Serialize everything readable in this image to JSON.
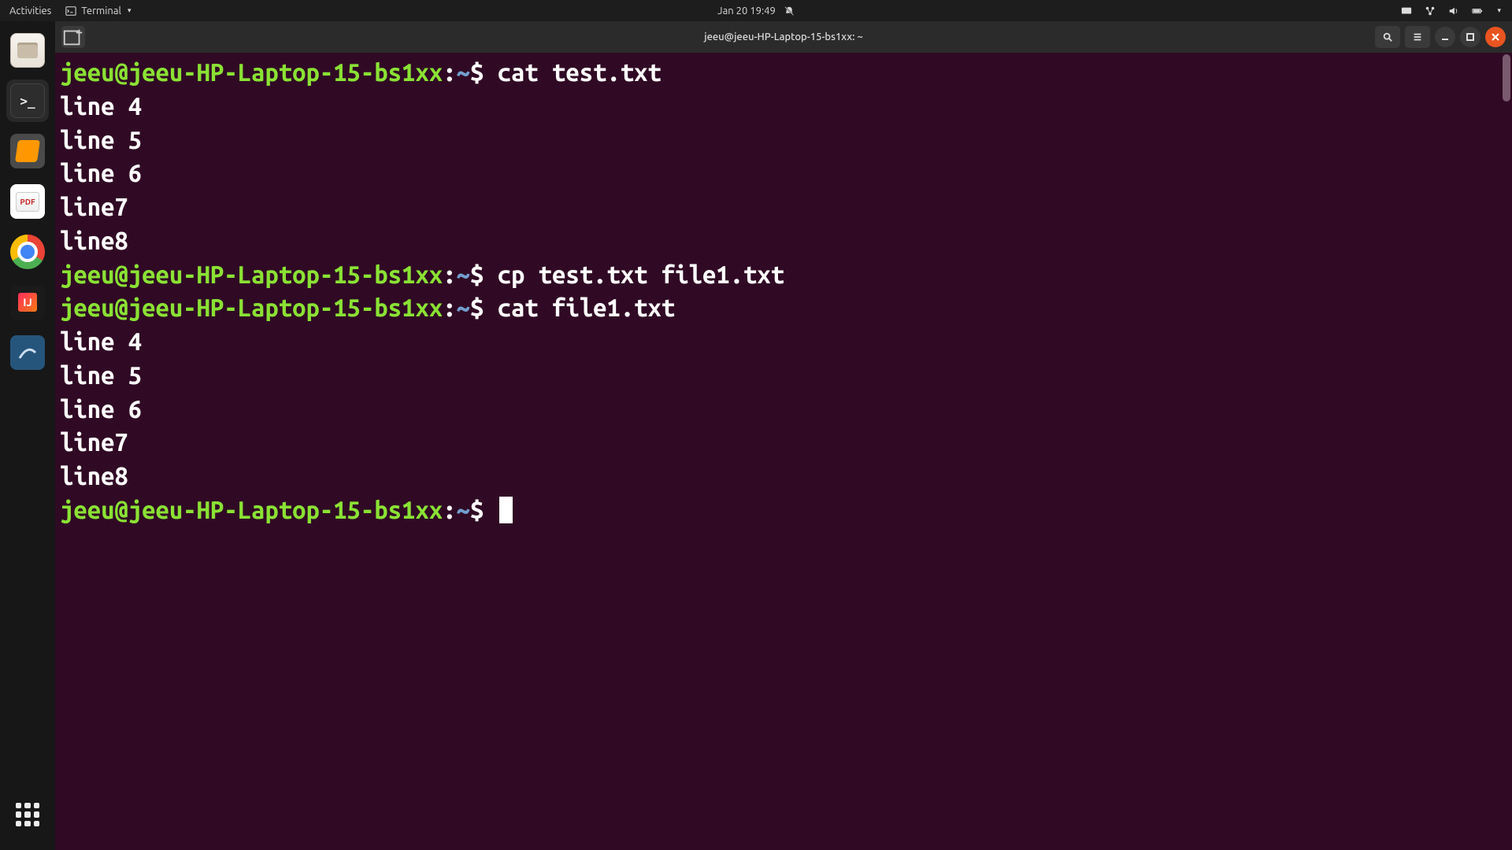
{
  "top_panel": {
    "activities": "Activities",
    "app_name": "Terminal",
    "clock": "Jan 20  19:49"
  },
  "dock": {
    "items": [
      {
        "name": "files",
        "label": "Files"
      },
      {
        "name": "terminal",
        "label": "Terminal"
      },
      {
        "name": "sublime",
        "label": "Sublime Text"
      },
      {
        "name": "pdf",
        "label": "Document Viewer"
      },
      {
        "name": "chrome",
        "label": "Google Chrome"
      },
      {
        "name": "intellij",
        "label": "IntelliJ IDEA"
      },
      {
        "name": "workbench",
        "label": "MySQL Workbench"
      }
    ]
  },
  "window": {
    "title": "jeeu@jeeu-HP-Laptop-15-bs1xx: ~"
  },
  "terminal": {
    "prompt": {
      "user_host": "jeeu@jeeu-HP-Laptop-15-bs1xx",
      "path": "~",
      "symbol": "$"
    },
    "session": [
      {
        "type": "cmd",
        "text": "cat test.txt"
      },
      {
        "type": "out",
        "text": "line 4"
      },
      {
        "type": "out",
        "text": "line 5"
      },
      {
        "type": "out",
        "text": "line 6"
      },
      {
        "type": "out",
        "text": "line7"
      },
      {
        "type": "out",
        "text": "line8"
      },
      {
        "type": "cmd",
        "text": "cp test.txt file1.txt"
      },
      {
        "type": "cmd",
        "text": "cat file1.txt"
      },
      {
        "type": "out",
        "text": "line 4"
      },
      {
        "type": "out",
        "text": "line 5"
      },
      {
        "type": "out",
        "text": "line 6"
      },
      {
        "type": "out",
        "text": "line7"
      },
      {
        "type": "out",
        "text": "line8"
      },
      {
        "type": "cmd",
        "text": ""
      }
    ]
  }
}
